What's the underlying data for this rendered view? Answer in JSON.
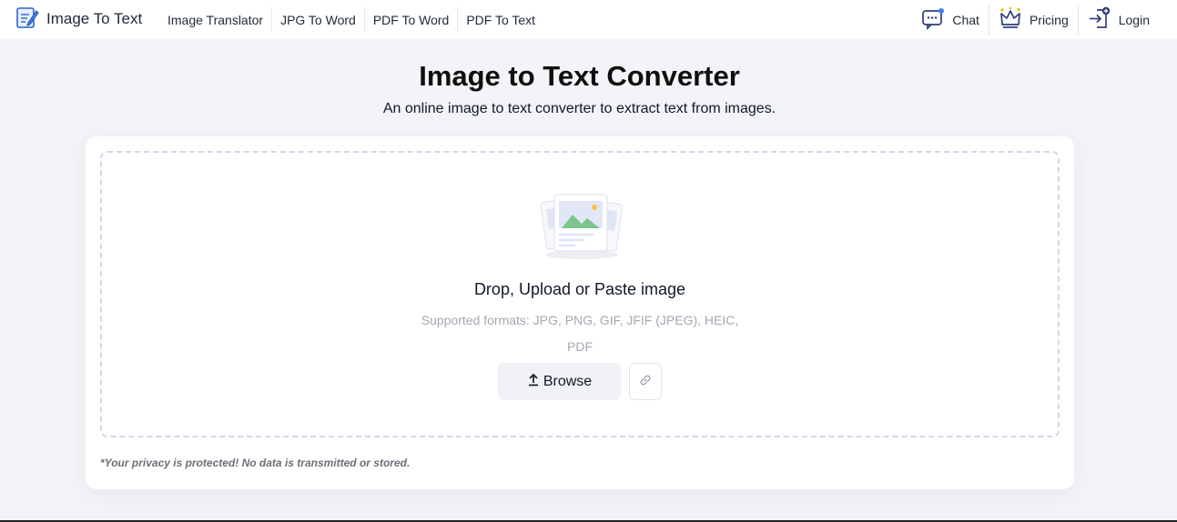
{
  "brand": {
    "name": "Image To Text",
    "icon": "notepad-pencil-icon"
  },
  "nav": [
    {
      "label": "Image Translator"
    },
    {
      "label": "JPG To Word"
    },
    {
      "label": "PDF To Word"
    },
    {
      "label": "PDF To Text"
    }
  ],
  "right_nav": {
    "chat": {
      "label": "Chat",
      "icon": "chat-bubble-icon"
    },
    "pricing": {
      "label": "Pricing",
      "icon": "crown-icon"
    },
    "login": {
      "label": "Login",
      "icon": "login-arrow-icon"
    }
  },
  "hero": {
    "title": "Image to Text Converter",
    "subtitle": "An online image to text converter to extract text from images."
  },
  "upload": {
    "illustration": "image-files-illustration",
    "title": "Drop, Upload or Paste image",
    "formats": "Supported formats: JPG, PNG, GIF, JFIF (JPEG), HEIC, PDF",
    "browse_label": "Browse",
    "browse_icon": "upload-arrow-icon",
    "link_icon": "link-icon"
  },
  "privacy": "*Your privacy is protected! No data is transmitted or stored.",
  "colors": {
    "accent_blue": "#2f63c9",
    "page_bg": "#f3f4f8",
    "dropzone_border": "#d4d6ec"
  }
}
